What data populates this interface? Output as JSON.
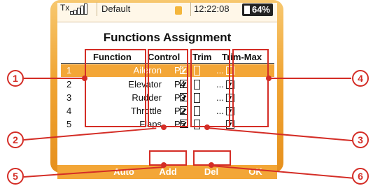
{
  "status": {
    "tx_label": "Tx",
    "model": "Default",
    "time": "12:22:08",
    "battery": "64%"
  },
  "title": "Functions Assignment",
  "table": {
    "headers": {
      "function": "Function",
      "control": "Control",
      "trim": "Trim",
      "trim_max": "Trim-Max"
    },
    "rows": [
      {
        "num": "1",
        "function": "Aileron",
        "control": "P1",
        "trim": "..."
      },
      {
        "num": "2",
        "function": "Elevator",
        "control": "P4",
        "trim": "..."
      },
      {
        "num": "3",
        "function": "Rudder",
        "control": "P3",
        "trim": "..."
      },
      {
        "num": "4",
        "function": "Throttle",
        "control": "P2",
        "trim": "..."
      },
      {
        "num": "5",
        "function": "Flaps",
        "control": "P5",
        "trim": "..."
      }
    ],
    "selected_index": 0
  },
  "buttons": {
    "auto": "Auto",
    "add": "Add",
    "del": "Del",
    "ok": "OK"
  },
  "callouts": [
    "1",
    "2",
    "3",
    "4",
    "5",
    "6"
  ],
  "colors": {
    "accent": "#f3a637",
    "callout": "#d42d26"
  }
}
